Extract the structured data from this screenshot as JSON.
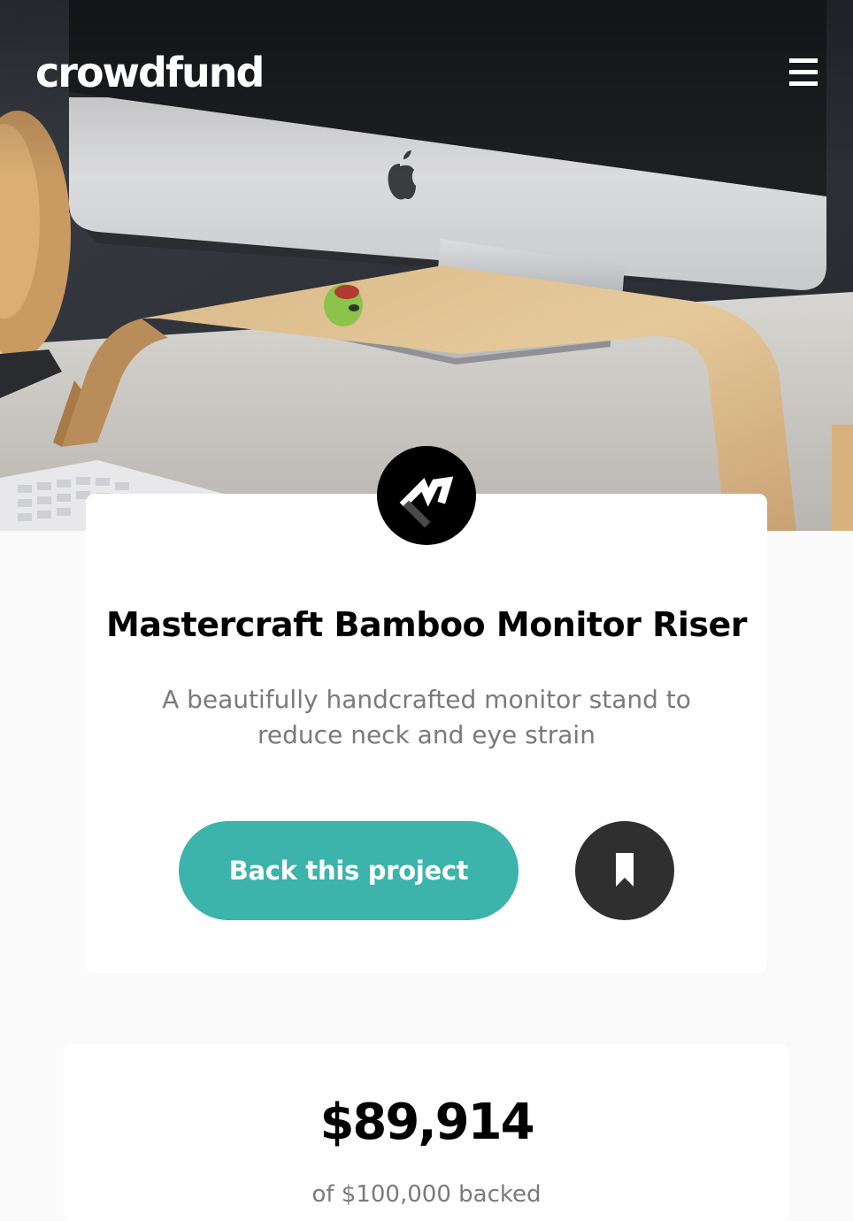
{
  "header": {
    "logo_text": "crowdfund",
    "menu_icon": "hamburger-menu-icon"
  },
  "hero": {
    "image_description_icon": "desk-monitor-photo"
  },
  "project": {
    "badge_icon": "mastercraft-logo-icon",
    "title": "Mastercraft Bamboo Monitor Riser",
    "description": "A beautifully handcrafted monitor stand to reduce neck and eye strain",
    "back_button_label": "Back this project",
    "bookmark_icon": "bookmark-icon"
  },
  "stats": {
    "amount": "$89,914",
    "caption": "of $100,000 backed"
  },
  "colors": {
    "accent": "#3cb3ab",
    "dark": "#2f2f2f",
    "text_muted": "#7a7a7a",
    "page_background": "#fafafa"
  }
}
